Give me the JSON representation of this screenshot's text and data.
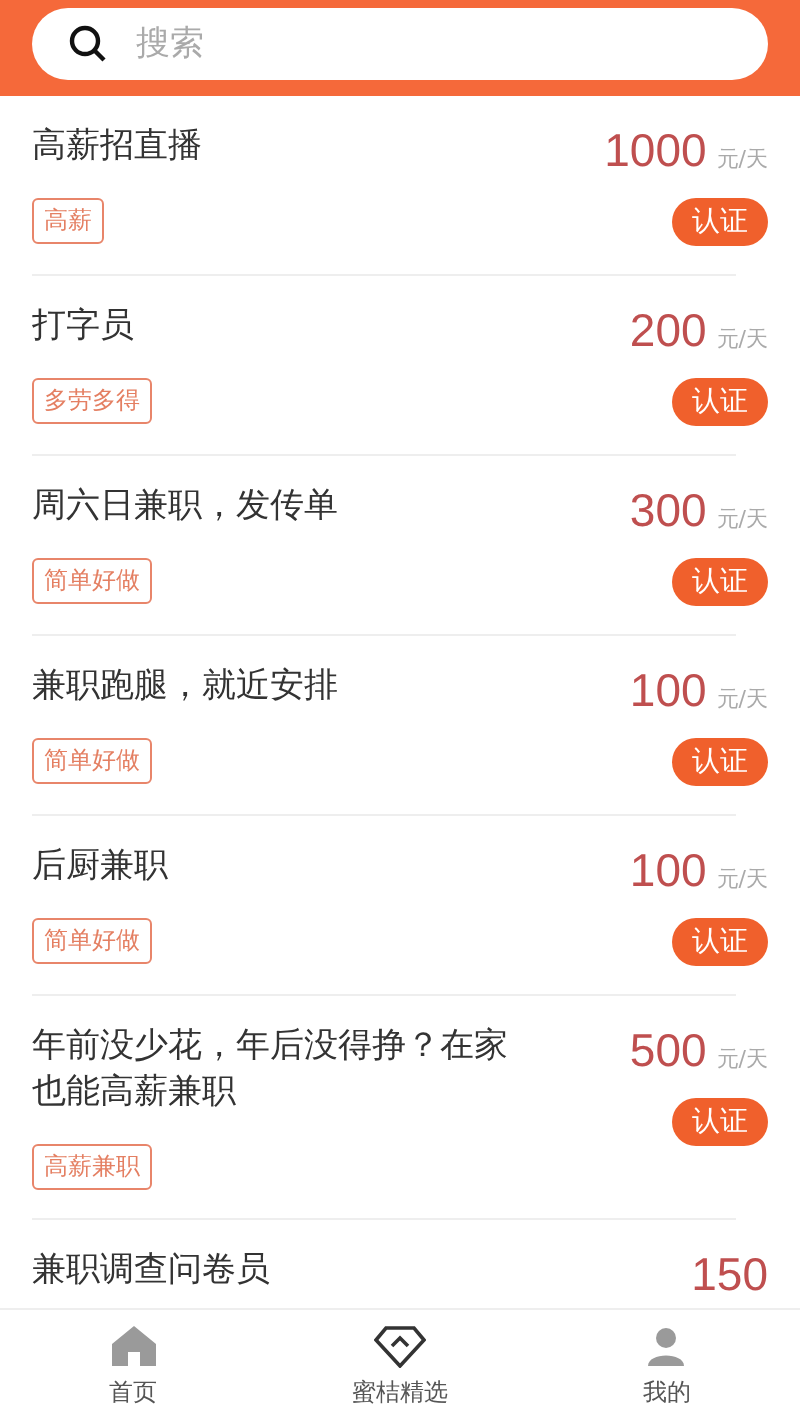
{
  "search": {
    "placeholder": "搜索"
  },
  "jobs": [
    {
      "title": "高薪招直播",
      "price": "1000",
      "unit": "元/天",
      "tag": "高薪",
      "badge": "认证"
    },
    {
      "title": "打字员",
      "price": "200",
      "unit": "元/天",
      "tag": "多劳多得",
      "badge": "认证"
    },
    {
      "title": "周六日兼职，发传单",
      "price": "300",
      "unit": "元/天",
      "tag": "简单好做",
      "badge": "认证"
    },
    {
      "title": "兼职跑腿，就近安排",
      "price": "100",
      "unit": "元/天",
      "tag": "简单好做",
      "badge": "认证"
    },
    {
      "title": "后厨兼职",
      "price": "100",
      "unit": "元/天",
      "tag": "简单好做",
      "badge": "认证"
    },
    {
      "title": "年前没少花，年后没得挣？在家也能高薪兼职",
      "price": "500",
      "unit": "元/天",
      "tag": "高薪兼职",
      "badge": "认证"
    },
    {
      "title": "兼职调查问卷员",
      "price": "150"
    }
  ],
  "tabbar": [
    {
      "label": "首页",
      "kind": "home"
    },
    {
      "label": "蜜桔精选",
      "kind": "gem"
    },
    {
      "label": "我的",
      "kind": "user"
    }
  ]
}
